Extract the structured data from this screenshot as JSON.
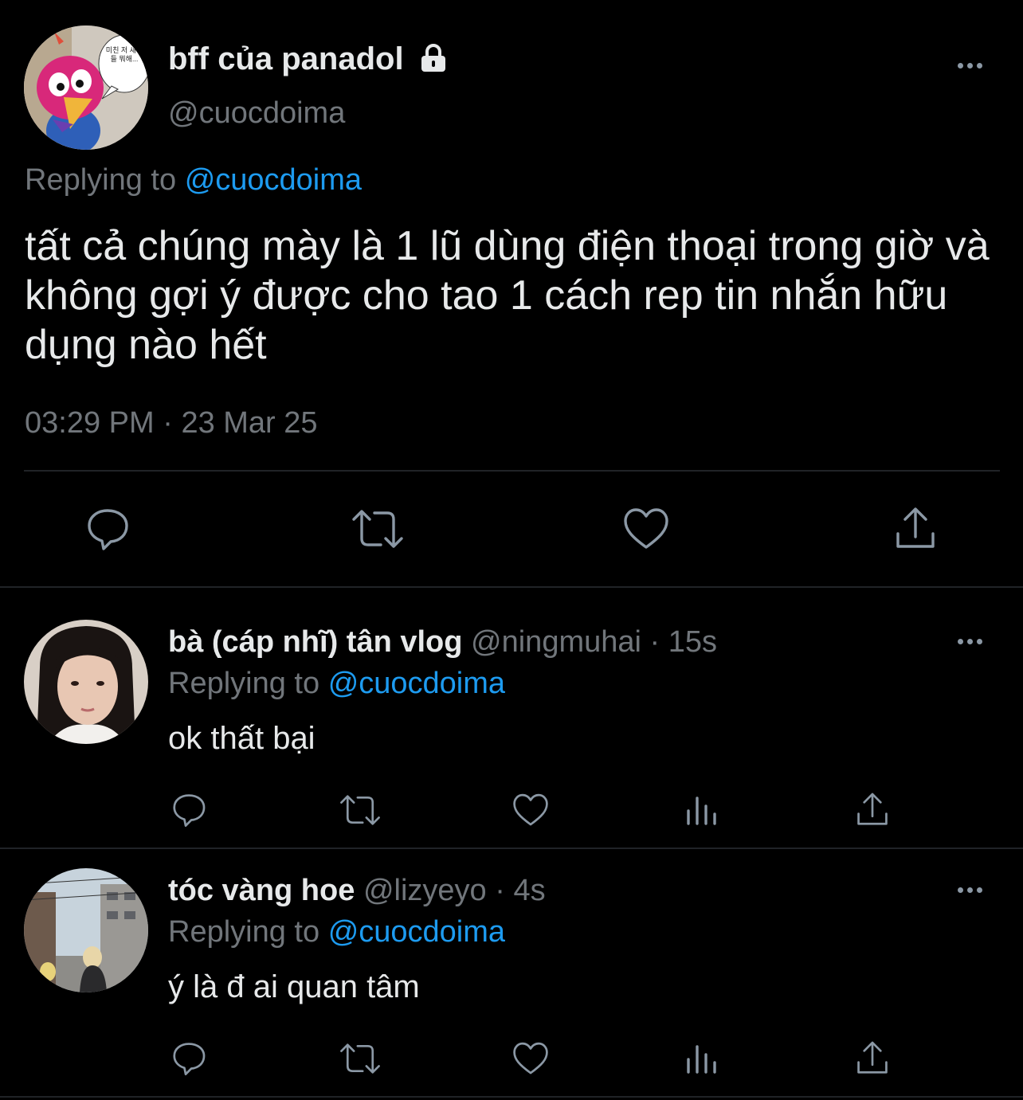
{
  "main_tweet": {
    "display_name": "bff của panadol",
    "handle": "@cuocdoima",
    "avatar_bubble_text": "미친 저 새키들 뭐해...",
    "replying_label": "Replying to",
    "replying_handle": "@cuocdoima",
    "text": "tất cả chúng mày là 1 lũ dùng điện thoại trong giờ và không gợi ý được cho tao 1 cách rep tin nhắn hữu dụng nào hết",
    "time": "03:29 PM",
    "separator": "·",
    "date": "23 Mar 25"
  },
  "replies": [
    {
      "display_name": "bà (cáp nhĩ) tân vlog",
      "handle": "@ningmuhai",
      "age": "· 15s",
      "replying_label": "Replying to",
      "replying_handle": "@cuocdoima",
      "text": "ok thất bại"
    },
    {
      "display_name": "tóc vàng hoe",
      "handle": "@lizyeyo",
      "age": "· 4s",
      "replying_label": "Replying to",
      "replying_handle": "@cuocdoima",
      "text": "ý là đ ai quan tâm"
    }
  ],
  "icons": [
    "lock-icon",
    "more-icon",
    "reply-icon",
    "retweet-icon",
    "like-icon",
    "views-icon",
    "share-icon"
  ],
  "colors": {
    "background": "#000000",
    "text": "#e7e9ea",
    "muted": "#71767b",
    "link": "#1d9bf0",
    "divider": "#202327"
  }
}
